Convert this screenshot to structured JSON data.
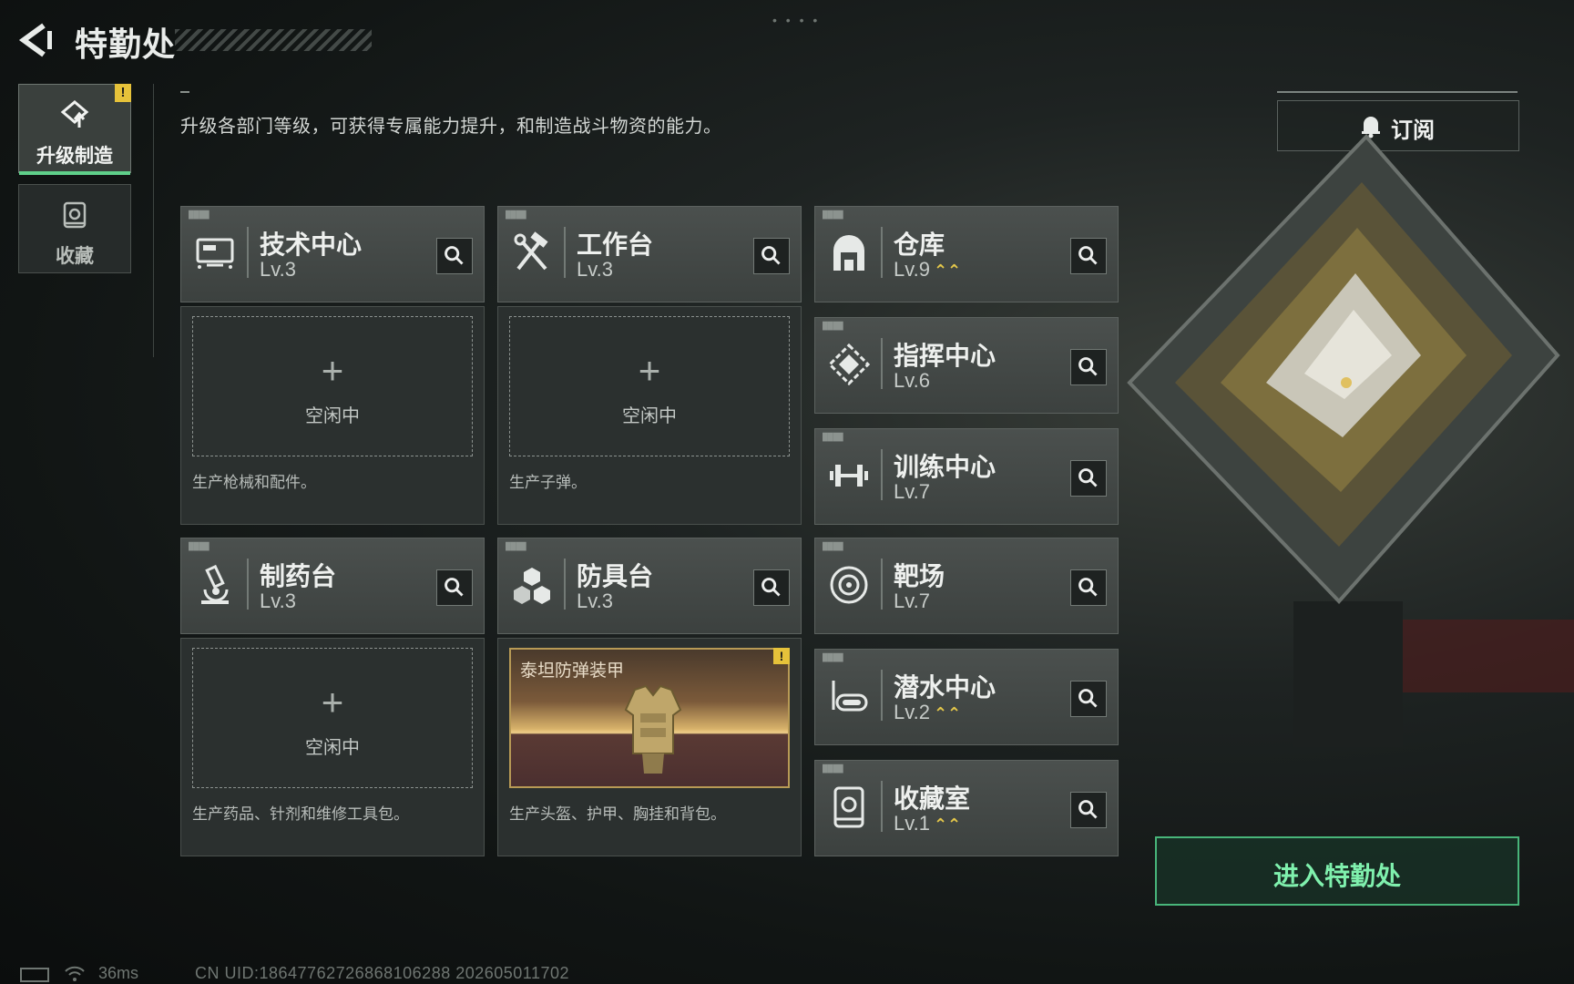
{
  "header": {
    "title": "特勤处",
    "dots": "• • • •"
  },
  "nav": {
    "upgrade": {
      "label": "升级制造",
      "alert": "!"
    },
    "collection": {
      "label": "收藏"
    }
  },
  "description": "升级各部门等级，可获得专属能力提升，和制造战斗物资的能力。",
  "subscribe": {
    "label": "订阅"
  },
  "facilities_left": [
    {
      "name": "技术中心",
      "level": "Lv.3",
      "icon": "monitor-icon",
      "slot_plus": "+",
      "slot_status": "空闲中",
      "desc": "生产枪械和配件。"
    },
    {
      "name": "工作台",
      "level": "Lv.3",
      "icon": "hammer-wrench-icon",
      "slot_plus": "+",
      "slot_status": "空闲中",
      "desc": "生产子弹。"
    },
    {
      "name": "制药台",
      "level": "Lv.3",
      "icon": "microscope-icon",
      "slot_plus": "+",
      "slot_status": "空闲中",
      "desc": "生产药品、针剂和维修工具包。"
    },
    {
      "name": "防具台",
      "level": "Lv.3",
      "icon": "cubes-icon",
      "product": "泰坦防弹装甲",
      "product_alert": "!",
      "desc": "生产头盔、护甲、胸挂和背包。"
    }
  ],
  "facilities_right": [
    {
      "name": "仓库",
      "level": "Lv.9",
      "upgrade": "⌃⌃",
      "icon": "warehouse-icon"
    },
    {
      "name": "指挥中心",
      "level": "Lv.6",
      "upgrade": "",
      "icon": "command-icon"
    },
    {
      "name": "训练中心",
      "level": "Lv.7",
      "upgrade": "",
      "icon": "dumbbell-icon"
    },
    {
      "name": "靶场",
      "level": "Lv.7",
      "upgrade": "",
      "icon": "target-icon"
    },
    {
      "name": "潜水中心",
      "level": "Lv.2",
      "upgrade": "⌃⌃",
      "icon": "diving-mask-icon"
    },
    {
      "name": "收藏室",
      "level": "Lv.1",
      "upgrade": "⌃⌃",
      "icon": "collection-room-icon"
    }
  ],
  "enter_button": {
    "label": "进入特勤处"
  },
  "footer": {
    "ping": "36ms",
    "uid": "CN UID:18647762726868106288 202605011702"
  },
  "colors": {
    "accent_green": "#5fd08a",
    "alert_yellow": "#e6c23a",
    "upgrade_gold": "#e5c84a"
  }
}
